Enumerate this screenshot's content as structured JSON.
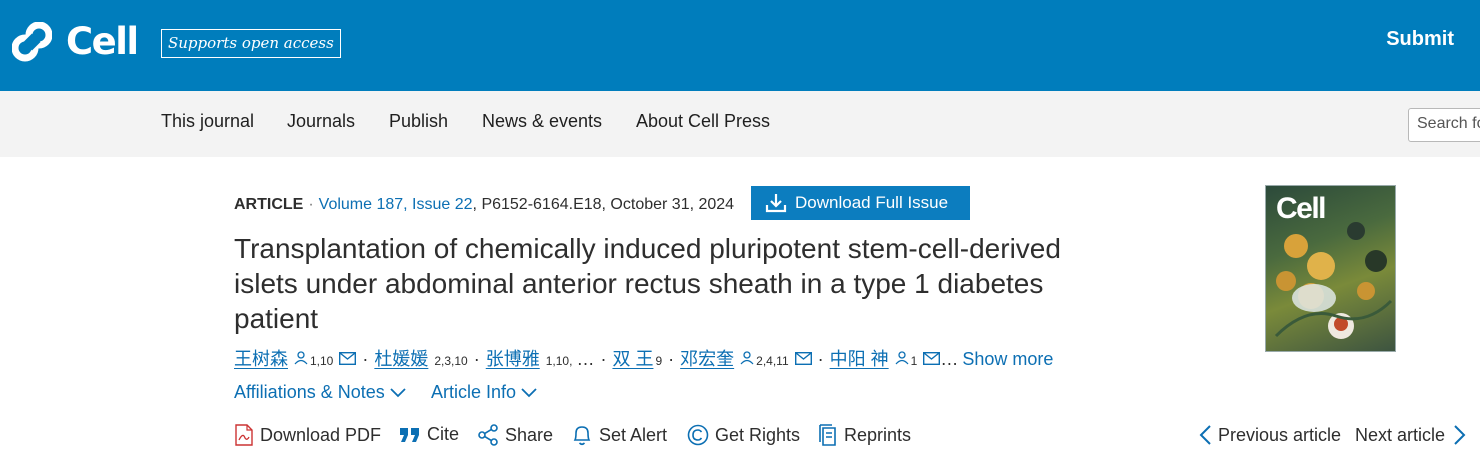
{
  "header": {
    "logo_text": "Cell",
    "oa_badge": "Supports open access",
    "submit_label": "Submit"
  },
  "nav": {
    "items": [
      "This journal",
      "Journals",
      "Publish",
      "News & events",
      "About Cell Press"
    ],
    "search_placeholder": "Search fo"
  },
  "article": {
    "type": "ARTICLE",
    "volume_issue": "Volume 187, Issue 22",
    "pages_date": "P6152-6164.E18, October 31, 2024",
    "download_issue_label": "Download Full Issue",
    "title": "Transplantation of chemically induced pluripotent stem-cell-derived islets under abdominal anterior rectus sheath in a type 1 diabetes patient",
    "authors": [
      {
        "name": "王树森",
        "sup": "1,10"
      },
      {
        "name": "杜媛媛",
        "sup": "2,3,10"
      },
      {
        "name": "张博雅",
        "sup": "1,10,"
      },
      {
        "name": "双 王",
        "sup": "9"
      },
      {
        "name": "邓宏奎",
        "sup": "2,4,11"
      },
      {
        "name": "中阳 神",
        "sup": "1"
      }
    ],
    "ellipsis": "…",
    "trailing_ellipsis": "…",
    "show_more": "Show more",
    "affiliations_label": "Affiliations & Notes",
    "article_info_label": "Article Info"
  },
  "actions": {
    "download_pdf": "Download PDF",
    "cite": "Cite",
    "share": "Share",
    "set_alert": "Set Alert",
    "get_rights": "Get Rights",
    "reprints": "Reprints",
    "previous_article": "Previous article",
    "next_article": "Next article"
  },
  "cover": {
    "title": "Cell"
  },
  "colors": {
    "brand_blue": "#007dbc",
    "link_blue": "#0c6fb3",
    "nav_bg": "#f3f3f3"
  }
}
